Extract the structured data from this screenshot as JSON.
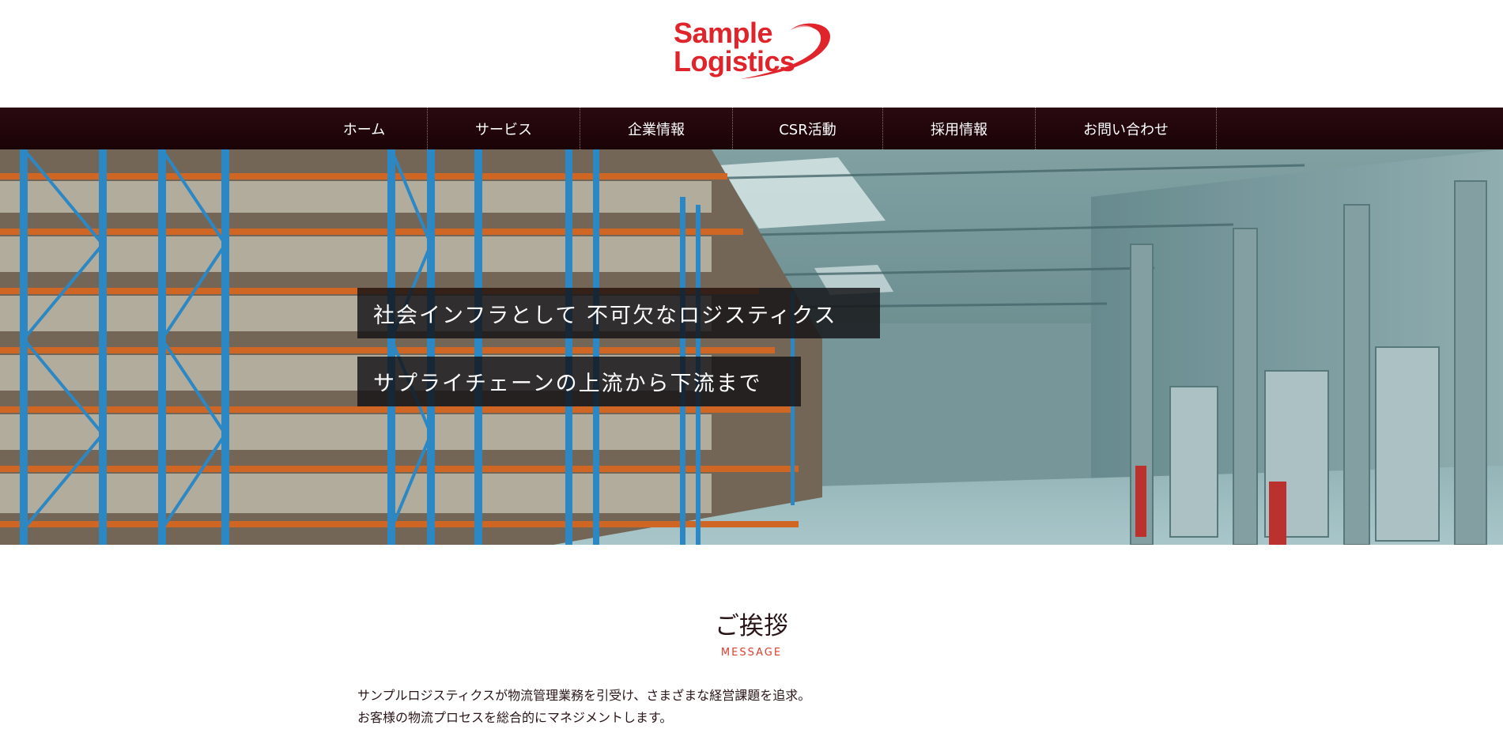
{
  "logo": {
    "line1": "Sample",
    "line2": "Logistics",
    "brand_color": "#e0242b"
  },
  "nav": {
    "items": [
      {
        "label": "ホーム"
      },
      {
        "label": "サービス"
      },
      {
        "label": "企業情報"
      },
      {
        "label": "CSR活動"
      },
      {
        "label": "採用情報"
      },
      {
        "label": "お問い合わせ"
      }
    ],
    "background": "#1f0509"
  },
  "hero": {
    "caption_line1": "社会インフラとして 不可欠なロジスティクス",
    "caption_line2": "サプライチェーンの上流から下流まで"
  },
  "message": {
    "title": "ご挨拶",
    "subtitle": "MESSAGE",
    "subtitle_color": "#d9402e",
    "paragraph_line1": "サンプルロジスティクスが物流管理業務を引受け、さまざまな経営課題を追求。",
    "paragraph_line2": "お客様の物流プロセスを総合的にマネジメントします。"
  }
}
